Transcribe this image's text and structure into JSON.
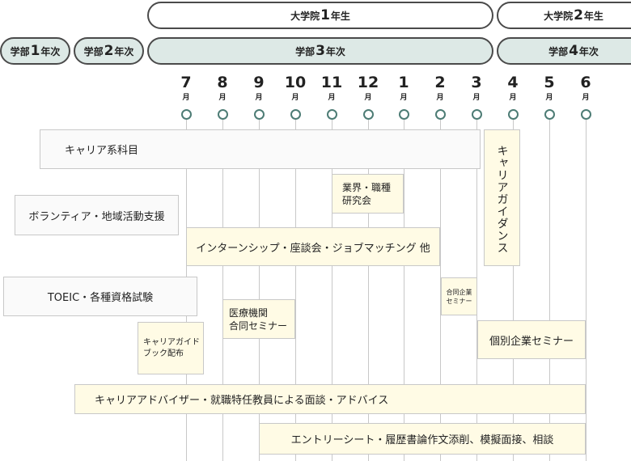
{
  "years": {
    "grad1": {
      "pre": "大学院",
      "num": "1",
      "post": "年生"
    },
    "grad2": {
      "pre": "大学院",
      "num": "2",
      "post": "年生"
    },
    "ug1": {
      "pre": "学部",
      "num": "1",
      "post": "年次"
    },
    "ug2": {
      "pre": "学部",
      "num": "2",
      "post": "年次"
    },
    "ug3": {
      "pre": "学部",
      "num": "3",
      "post": "年次"
    },
    "ug4": {
      "pre": "学部",
      "num": "4",
      "post": "年次"
    }
  },
  "months": [
    {
      "num": "7",
      "unit": "月"
    },
    {
      "num": "8",
      "unit": "月"
    },
    {
      "num": "9",
      "unit": "月"
    },
    {
      "num": "10",
      "unit": "月"
    },
    {
      "num": "11",
      "unit": "月"
    },
    {
      "num": "12",
      "unit": "月"
    },
    {
      "num": "1",
      "unit": "月"
    },
    {
      "num": "2",
      "unit": "月"
    },
    {
      "num": "3",
      "unit": "月"
    },
    {
      "num": "4",
      "unit": "月"
    },
    {
      "num": "5",
      "unit": "月"
    },
    {
      "num": "6",
      "unit": "月"
    }
  ],
  "activities": {
    "career_courses": "キャリア系科目",
    "industry_study": "業界・職種\n研究会",
    "volunteer": "ボランティア・地域活動支援",
    "internship": "インターンシップ・座談会・ジョブマッチング 他",
    "career_guidance": "キャリアガイダンス",
    "toeic": "TOEIC・各種資格試験",
    "medical_seminar": "医療機関\n合同セミナー",
    "joint_company_seminar": "合同企業\nセミナー",
    "career_guidebook": "キャリアガイド\nブック配布",
    "individual_seminar": "個別企業セミナー",
    "advisor": "キャリアアドバイザー・就職特任教員による面談・アドバイス",
    "entry_sheet": "エントリーシート・履歴書論作文添削、模擬面接、相談"
  }
}
